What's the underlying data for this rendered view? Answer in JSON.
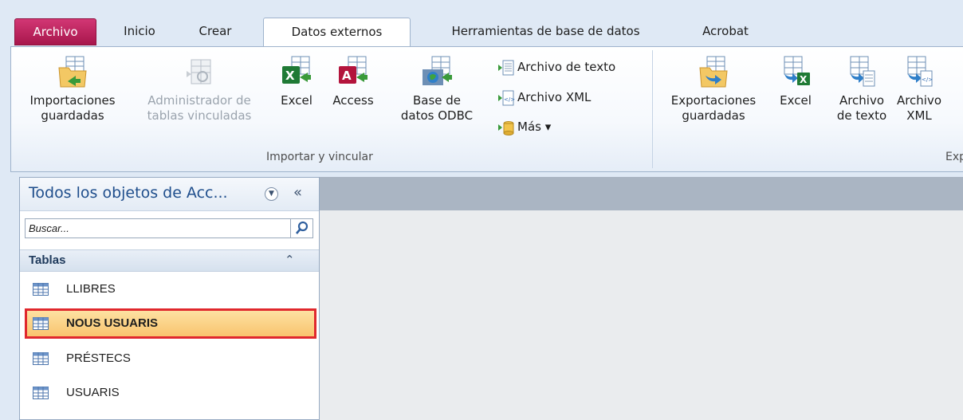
{
  "tabs": [
    {
      "label": "Archivo"
    },
    {
      "label": "Inicio"
    },
    {
      "label": "Crear"
    },
    {
      "label": "Datos externos"
    },
    {
      "label": "Herramientas de base de datos"
    },
    {
      "label": "Acrobat"
    }
  ],
  "ribbon": {
    "import_group": {
      "label": "Importar y vincular",
      "saved_imports": [
        "Importaciones",
        "guardadas"
      ],
      "linked_table_manager": [
        "Administrador de",
        "tablas vinculadas"
      ],
      "excel": "Excel",
      "access": "Access",
      "odbc": [
        "Base de",
        "datos ODBC"
      ],
      "text_file": "Archivo de texto",
      "xml_file": "Archivo XML",
      "more": "Más ▾"
    },
    "export_group": {
      "label": "Exp",
      "saved_exports": [
        "Exportaciones",
        "guardadas"
      ],
      "excel": "Excel",
      "text_file": [
        "Archivo",
        "de texto"
      ],
      "xml_file": [
        "Archivo",
        "XML"
      ]
    }
  },
  "nav": {
    "title": "Todos los objetos de Acc...",
    "collapse_glyph": "«",
    "search_placeholder": "Buscar...",
    "section": "Tablas",
    "items": [
      {
        "label": "LLIBRES"
      },
      {
        "label": "NOUS USUARIS",
        "selected": true
      },
      {
        "label": "PRÉSTECS"
      },
      {
        "label": "USUARIS"
      }
    ]
  },
  "colors": {
    "file_tab": "#b8205a",
    "selection_border": "#e0282d",
    "selection_fill": "#f9c46e"
  }
}
